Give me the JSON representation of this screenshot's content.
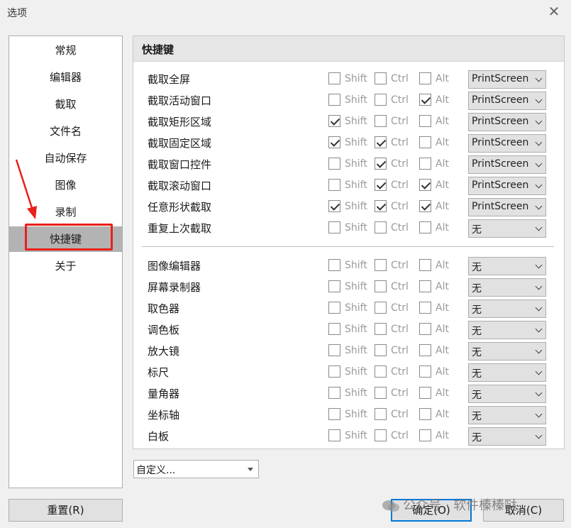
{
  "window": {
    "title": "选项",
    "close_glyph": "✕"
  },
  "nav": {
    "items": [
      "常规",
      "编辑器",
      "截取",
      "文件名",
      "自动保存",
      "图像",
      "录制",
      "快捷键",
      "关于"
    ],
    "active": "快捷键"
  },
  "panel": {
    "header": "快捷键",
    "modifiers": {
      "shift": "Shift",
      "ctrl": "Ctrl",
      "alt": "Alt"
    },
    "capture_rows": [
      {
        "label": "截取全屏",
        "shift": false,
        "ctrl": false,
        "alt": false,
        "key": "PrintScreen"
      },
      {
        "label": "截取活动窗口",
        "shift": false,
        "ctrl": false,
        "alt": true,
        "key": "PrintScreen"
      },
      {
        "label": "截取矩形区域",
        "shift": true,
        "ctrl": false,
        "alt": false,
        "key": "PrintScreen"
      },
      {
        "label": "截取固定区域",
        "shift": true,
        "ctrl": true,
        "alt": false,
        "key": "PrintScreen"
      },
      {
        "label": "截取窗口控件",
        "shift": false,
        "ctrl": true,
        "alt": false,
        "key": "PrintScreen"
      },
      {
        "label": "截取滚动窗口",
        "shift": false,
        "ctrl": true,
        "alt": true,
        "key": "PrintScreen"
      },
      {
        "label": "任意形状截取",
        "shift": true,
        "ctrl": true,
        "alt": true,
        "key": "PrintScreen"
      },
      {
        "label": "重复上次截取",
        "shift": false,
        "ctrl": false,
        "alt": false,
        "key": "无"
      }
    ],
    "tool_rows": [
      {
        "label": "图像编辑器",
        "shift": false,
        "ctrl": false,
        "alt": false,
        "key": "无"
      },
      {
        "label": "屏幕录制器",
        "shift": false,
        "ctrl": false,
        "alt": false,
        "key": "无"
      },
      {
        "label": "取色器",
        "shift": false,
        "ctrl": false,
        "alt": false,
        "key": "无"
      },
      {
        "label": "调色板",
        "shift": false,
        "ctrl": false,
        "alt": false,
        "key": "无"
      },
      {
        "label": "放大镜",
        "shift": false,
        "ctrl": false,
        "alt": false,
        "key": "无"
      },
      {
        "label": "标尺",
        "shift": false,
        "ctrl": false,
        "alt": false,
        "key": "无"
      },
      {
        "label": "量角器",
        "shift": false,
        "ctrl": false,
        "alt": false,
        "key": "无"
      },
      {
        "label": "坐标轴",
        "shift": false,
        "ctrl": false,
        "alt": false,
        "key": "无"
      },
      {
        "label": "白板",
        "shift": false,
        "ctrl": false,
        "alt": false,
        "key": "无"
      }
    ]
  },
  "preset": {
    "value": "自定义..."
  },
  "buttons": {
    "reset": "重置(R)",
    "ok": "确定(O)",
    "cancel": "取消(C)"
  },
  "watermark": "公众号 · 软件榛榛哒",
  "colors": {
    "highlight": "#e8211a",
    "primary_border": "#0078d7",
    "active_nav": "#b3b3b3"
  }
}
